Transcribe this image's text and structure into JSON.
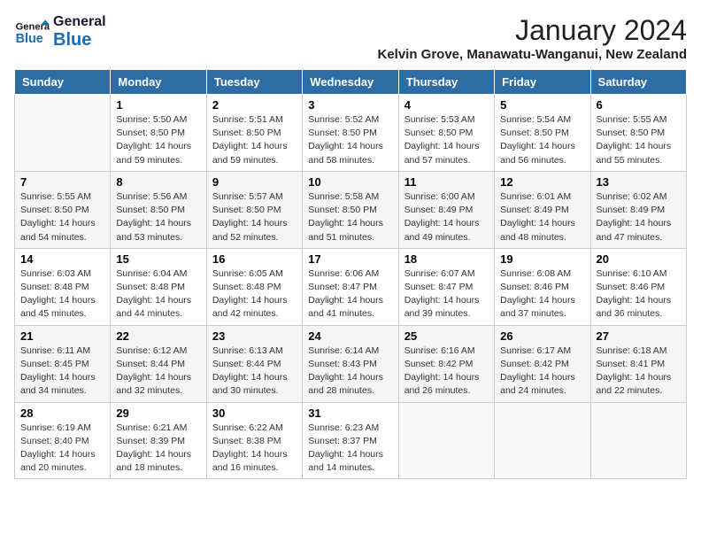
{
  "header": {
    "logo_general": "General",
    "logo_blue": "Blue",
    "title": "January 2024",
    "subtitle": "Kelvin Grove, Manawatu-Wanganui, New Zealand"
  },
  "calendar": {
    "days_of_week": [
      "Sunday",
      "Monday",
      "Tuesday",
      "Wednesday",
      "Thursday",
      "Friday",
      "Saturday"
    ],
    "weeks": [
      [
        {
          "day": "",
          "info": ""
        },
        {
          "day": "1",
          "info": "Sunrise: 5:50 AM\nSunset: 8:50 PM\nDaylight: 14 hours\nand 59 minutes."
        },
        {
          "day": "2",
          "info": "Sunrise: 5:51 AM\nSunset: 8:50 PM\nDaylight: 14 hours\nand 59 minutes."
        },
        {
          "day": "3",
          "info": "Sunrise: 5:52 AM\nSunset: 8:50 PM\nDaylight: 14 hours\nand 58 minutes."
        },
        {
          "day": "4",
          "info": "Sunrise: 5:53 AM\nSunset: 8:50 PM\nDaylight: 14 hours\nand 57 minutes."
        },
        {
          "day": "5",
          "info": "Sunrise: 5:54 AM\nSunset: 8:50 PM\nDaylight: 14 hours\nand 56 minutes."
        },
        {
          "day": "6",
          "info": "Sunrise: 5:55 AM\nSunset: 8:50 PM\nDaylight: 14 hours\nand 55 minutes."
        }
      ],
      [
        {
          "day": "7",
          "info": "Sunrise: 5:55 AM\nSunset: 8:50 PM\nDaylight: 14 hours\nand 54 minutes."
        },
        {
          "day": "8",
          "info": "Sunrise: 5:56 AM\nSunset: 8:50 PM\nDaylight: 14 hours\nand 53 minutes."
        },
        {
          "day": "9",
          "info": "Sunrise: 5:57 AM\nSunset: 8:50 PM\nDaylight: 14 hours\nand 52 minutes."
        },
        {
          "day": "10",
          "info": "Sunrise: 5:58 AM\nSunset: 8:50 PM\nDaylight: 14 hours\nand 51 minutes."
        },
        {
          "day": "11",
          "info": "Sunrise: 6:00 AM\nSunset: 8:49 PM\nDaylight: 14 hours\nand 49 minutes."
        },
        {
          "day": "12",
          "info": "Sunrise: 6:01 AM\nSunset: 8:49 PM\nDaylight: 14 hours\nand 48 minutes."
        },
        {
          "day": "13",
          "info": "Sunrise: 6:02 AM\nSunset: 8:49 PM\nDaylight: 14 hours\nand 47 minutes."
        }
      ],
      [
        {
          "day": "14",
          "info": "Sunrise: 6:03 AM\nSunset: 8:48 PM\nDaylight: 14 hours\nand 45 minutes."
        },
        {
          "day": "15",
          "info": "Sunrise: 6:04 AM\nSunset: 8:48 PM\nDaylight: 14 hours\nand 44 minutes."
        },
        {
          "day": "16",
          "info": "Sunrise: 6:05 AM\nSunset: 8:48 PM\nDaylight: 14 hours\nand 42 minutes."
        },
        {
          "day": "17",
          "info": "Sunrise: 6:06 AM\nSunset: 8:47 PM\nDaylight: 14 hours\nand 41 minutes."
        },
        {
          "day": "18",
          "info": "Sunrise: 6:07 AM\nSunset: 8:47 PM\nDaylight: 14 hours\nand 39 minutes."
        },
        {
          "day": "19",
          "info": "Sunrise: 6:08 AM\nSunset: 8:46 PM\nDaylight: 14 hours\nand 37 minutes."
        },
        {
          "day": "20",
          "info": "Sunrise: 6:10 AM\nSunset: 8:46 PM\nDaylight: 14 hours\nand 36 minutes."
        }
      ],
      [
        {
          "day": "21",
          "info": "Sunrise: 6:11 AM\nSunset: 8:45 PM\nDaylight: 14 hours\nand 34 minutes."
        },
        {
          "day": "22",
          "info": "Sunrise: 6:12 AM\nSunset: 8:44 PM\nDaylight: 14 hours\nand 32 minutes."
        },
        {
          "day": "23",
          "info": "Sunrise: 6:13 AM\nSunset: 8:44 PM\nDaylight: 14 hours\nand 30 minutes."
        },
        {
          "day": "24",
          "info": "Sunrise: 6:14 AM\nSunset: 8:43 PM\nDaylight: 14 hours\nand 28 minutes."
        },
        {
          "day": "25",
          "info": "Sunrise: 6:16 AM\nSunset: 8:42 PM\nDaylight: 14 hours\nand 26 minutes."
        },
        {
          "day": "26",
          "info": "Sunrise: 6:17 AM\nSunset: 8:42 PM\nDaylight: 14 hours\nand 24 minutes."
        },
        {
          "day": "27",
          "info": "Sunrise: 6:18 AM\nSunset: 8:41 PM\nDaylight: 14 hours\nand 22 minutes."
        }
      ],
      [
        {
          "day": "28",
          "info": "Sunrise: 6:19 AM\nSunset: 8:40 PM\nDaylight: 14 hours\nand 20 minutes."
        },
        {
          "day": "29",
          "info": "Sunrise: 6:21 AM\nSunset: 8:39 PM\nDaylight: 14 hours\nand 18 minutes."
        },
        {
          "day": "30",
          "info": "Sunrise: 6:22 AM\nSunset: 8:38 PM\nDaylight: 14 hours\nand 16 minutes."
        },
        {
          "day": "31",
          "info": "Sunrise: 6:23 AM\nSunset: 8:37 PM\nDaylight: 14 hours\nand 14 minutes."
        },
        {
          "day": "",
          "info": ""
        },
        {
          "day": "",
          "info": ""
        },
        {
          "day": "",
          "info": ""
        }
      ]
    ]
  }
}
